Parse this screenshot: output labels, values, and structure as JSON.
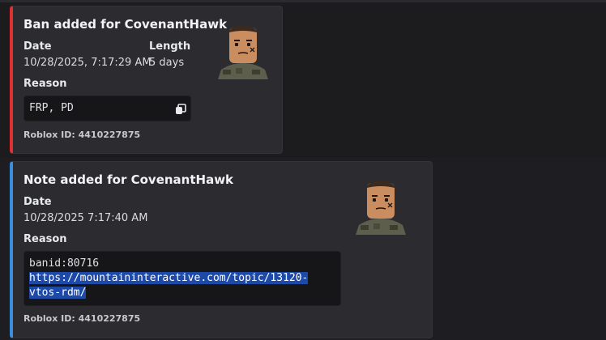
{
  "messages": [
    {
      "kind": "ban",
      "accent_color": "#e03030",
      "title": "Ban added for CovenantHawk",
      "fields": {
        "date_label": "Date",
        "date_value": "10/28/2025, 7:17:29 AM",
        "length_label": "Length",
        "length_value": "5 days",
        "reason_label": "Reason"
      },
      "reason_code": "FRP, PD",
      "copy_icon": "copy-icon",
      "footer": "Roblox ID: 4410227875"
    },
    {
      "kind": "note",
      "accent_color": "#3b8ddd",
      "title": "Note added for CovenantHawk",
      "fields": {
        "date_label": "Date",
        "date_value": "10/28/2025 7:17:40 AM",
        "reason_label": "Reason"
      },
      "reason_code_lines": [
        "banid:80716",
        "https://mountaininteractive.com/topic/13120-",
        "vtos-rdm/"
      ],
      "footer": "Roblox ID: 4410227875"
    }
  ]
}
